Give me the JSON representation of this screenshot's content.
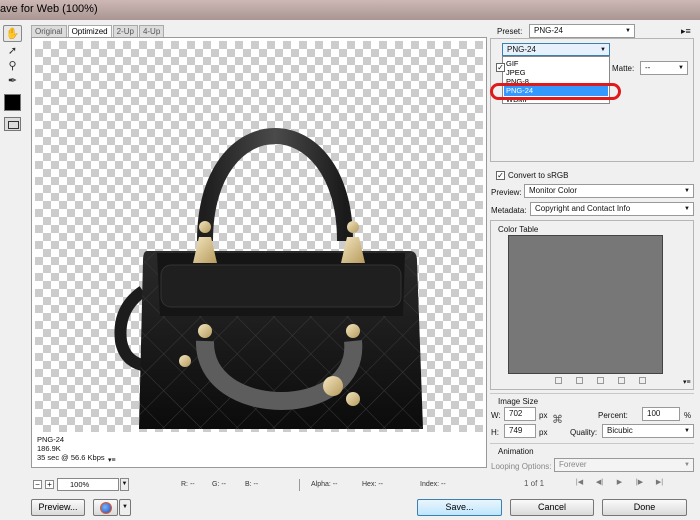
{
  "window": {
    "title": "ave for Web (100%)"
  },
  "toolbar": {
    "tools": [
      "hand-tool",
      "slice-select-tool",
      "zoom-tool",
      "eyedropper-tool"
    ]
  },
  "tabs": [
    "Original",
    "Optimized",
    "2-Up",
    "4-Up"
  ],
  "preview": {
    "info_format": "PNG-24",
    "info_size": "186.9K",
    "info_time": "35 sec @ 56.6 Kbps",
    "info_menu": "▾≡"
  },
  "statusbar": {
    "zoom_minus": "−",
    "zoom_plus": "+",
    "zoom": "100%",
    "readouts": [
      "R: --",
      "G: --",
      "B: --",
      "Alpha: --",
      "Hex: --",
      "Index: --"
    ]
  },
  "buttons": {
    "preview": "Preview...",
    "save": "Save...",
    "cancel": "Cancel",
    "done": "Done"
  },
  "settings": {
    "preset_label": "Preset:",
    "preset_value": "PNG-24",
    "format_value": "PNG-24",
    "format_options": [
      "GIF",
      "JPEG",
      "PNG-8",
      "PNG-24",
      "WBMP"
    ],
    "format_selected_index": 3,
    "matte_label": "Matte:",
    "matte_value": "--",
    "convert_label": "Convert to sRGB",
    "convert_checked": true,
    "preview_label": "Preview:",
    "preview_value": "Monitor Color",
    "metadata_label": "Metadata:",
    "metadata_value": "Copyright and Contact Info"
  },
  "color_table": {
    "label": "Color Table"
  },
  "image_size": {
    "label": "Image Size",
    "w_label": "W:",
    "w": "702",
    "h_label": "H:",
    "h": "749",
    "unit": "px",
    "percent_label": "Percent:",
    "percent": "100",
    "percent_unit": "%",
    "quality_label": "Quality:",
    "quality": "Bicubic"
  },
  "animation": {
    "label": "Animation",
    "looping_label": "Looping Options:",
    "looping_value": "Forever",
    "frame": "1 of 1"
  },
  "colors": {
    "accent": "#3399ff",
    "highlight_ring": "#e01a1a",
    "color_table_bg": "#777777"
  }
}
